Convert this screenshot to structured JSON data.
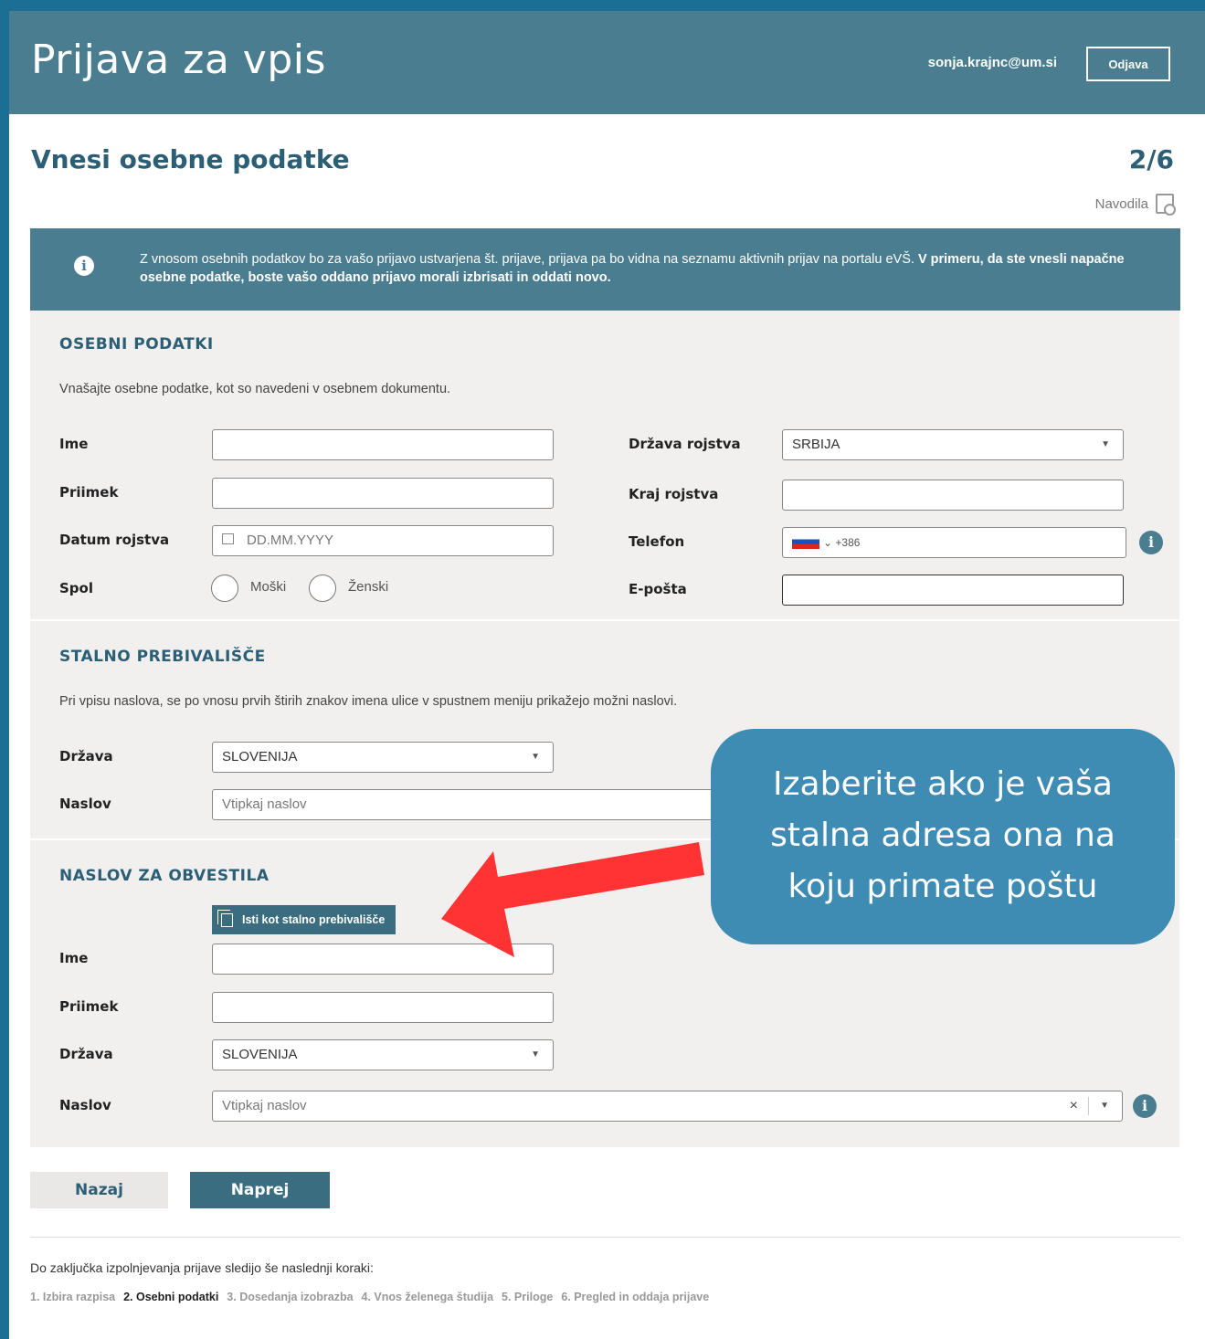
{
  "header": {
    "title": "Prijava za vpis",
    "user_email": "sonja.krajnc@um.si",
    "logout_label": "Odjava"
  },
  "page": {
    "heading": "Vnesi osebne podatke",
    "step": "2/6",
    "instructions_label": "Navodila"
  },
  "info": {
    "text_normal": "Z vnosom osebnih podatkov bo za vašo prijavo ustvarjena št. prijave, prijava pa bo vidna na seznamu aktivnih prijav na portalu eVŠ. ",
    "text_bold": "V primeru, da ste vnesli napačne osebne podatke, boste vašo oddano prijavo morali izbrisati in oddati novo."
  },
  "personal": {
    "title": "OSEBNI PODATKI",
    "description": "Vnašajte osebne podatke, kot so navedeni v osebnem dokumentu.",
    "first_name_label": "Ime",
    "last_name_label": "Priimek",
    "birth_date_label": "Datum rojstva",
    "birth_date_placeholder": "DD.MM.YYYY",
    "gender_label": "Spol",
    "gender_options": [
      "Moški",
      "Ženski"
    ],
    "birth_country_label": "Država rojstva",
    "birth_country_value": "SRBIJA",
    "birth_place_label": "Kraj rojstva",
    "phone_label": "Telefon",
    "phone_prefix": "+386",
    "email_label": "E-pošta"
  },
  "permanent": {
    "title": "STALNO PREBIVALIŠČE",
    "description": "Pri vpisu naslova, se po vnosu prvih štirih znakov imena ulice v spustnem meniju prikažejo možni naslovi.",
    "country_label": "Država",
    "country_value": "SLOVENIJA",
    "address_label": "Naslov",
    "address_placeholder": "Vtipkaj naslov"
  },
  "notification": {
    "title": "NASLOV ZA OBVESTILA",
    "copy_button": "Isti kot stalno prebivališče",
    "first_name_label": "Ime",
    "last_name_label": "Priimek",
    "country_label": "Država",
    "country_value": "SLOVENIJA",
    "address_label": "Naslov",
    "address_placeholder": "Vtipkaj naslov"
  },
  "nav": {
    "back": "Nazaj",
    "next": "Naprej"
  },
  "footer": {
    "remaining_text": "Do zaključka izpolnjevanja prijave sledijo še naslednji koraki:",
    "steps": [
      "1. Izbira razpisa",
      "2. Osebni podatki",
      "3. Dosedanja izobrazba",
      "4. Vnos želenega študija",
      "5. Priloge",
      "6. Pregled in oddaja prijave"
    ],
    "active_step_index": 1
  },
  "callout": {
    "lines": [
      "Izaberite ako je vaša",
      "stalna adresa ona na",
      "koju primate poštu"
    ]
  },
  "colors": {
    "header_bg": "#4a7d8f",
    "frame": "#1b6f94",
    "panel_bg": "#f1f0ef",
    "primary": "#3b6d80",
    "callout_bg": "#3e8bb4",
    "arrow": "#ff3333"
  }
}
